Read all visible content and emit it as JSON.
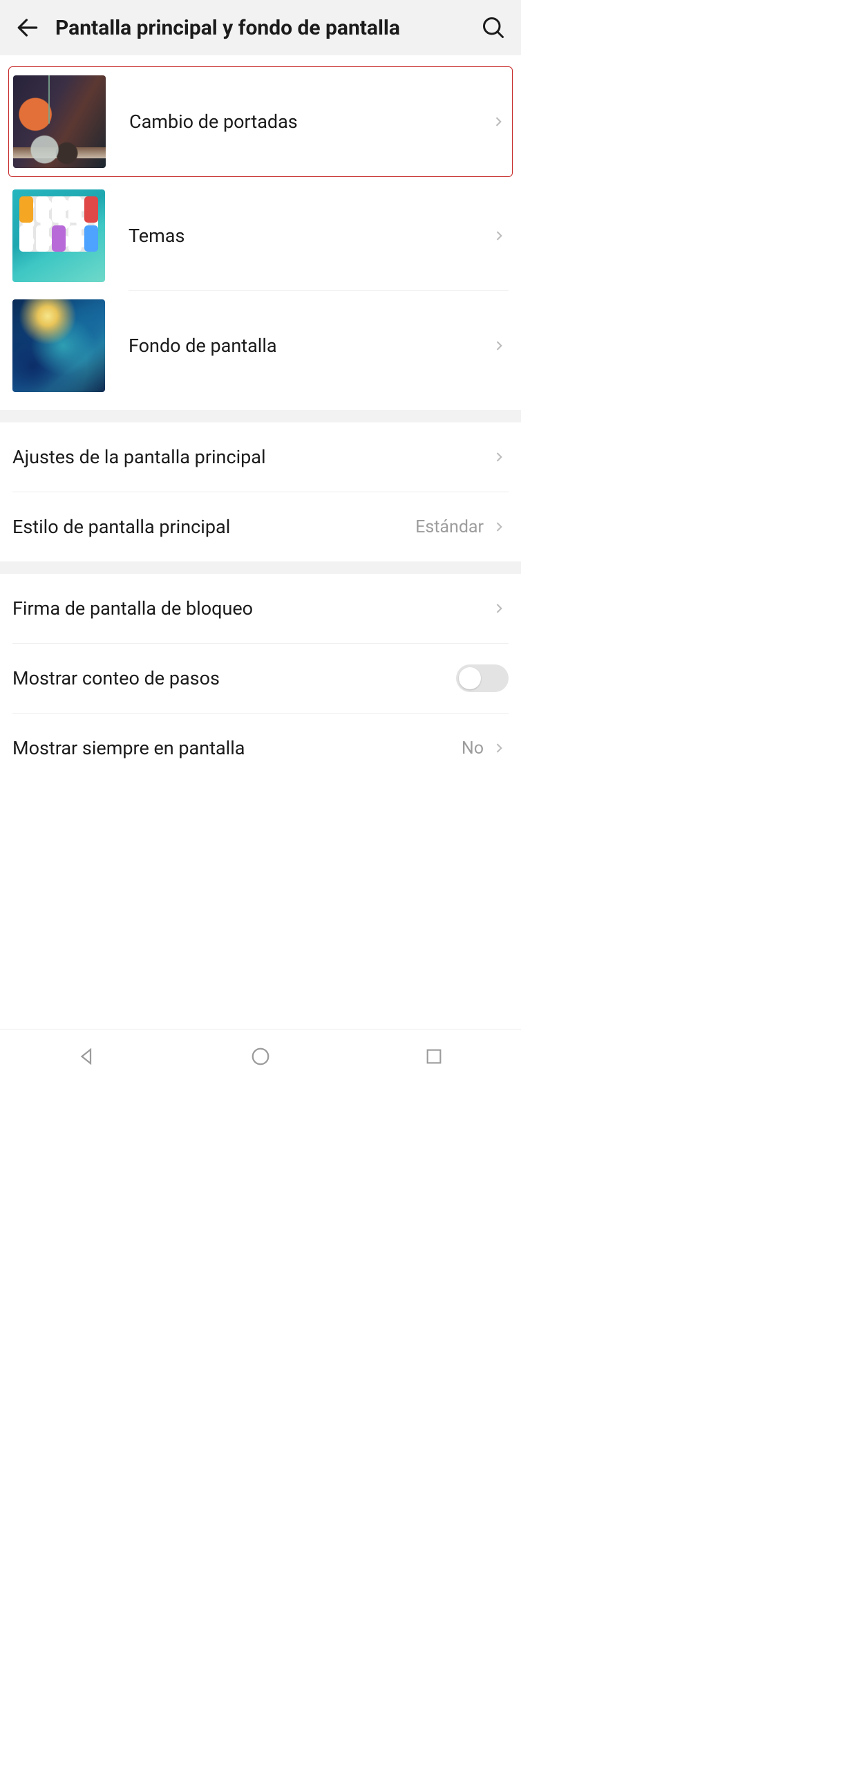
{
  "header": {
    "title": "Pantalla principal y fondo de pantalla"
  },
  "section1": {
    "items": [
      {
        "label": "Cambio de portadas"
      },
      {
        "label": "Temas"
      },
      {
        "label": "Fondo de pantalla"
      }
    ]
  },
  "section2": {
    "items": [
      {
        "label": "Ajustes de la pantalla principal",
        "value": ""
      },
      {
        "label": "Estilo de pantalla principal",
        "value": "Estándar"
      }
    ]
  },
  "section3": {
    "items": [
      {
        "label": "Firma de pantalla de bloqueo",
        "value": "",
        "type": "nav"
      },
      {
        "label": "Mostrar conteo de pasos",
        "type": "toggle",
        "on": false
      },
      {
        "label": "Mostrar siempre en pantalla",
        "value": "No",
        "type": "nav"
      }
    ]
  }
}
